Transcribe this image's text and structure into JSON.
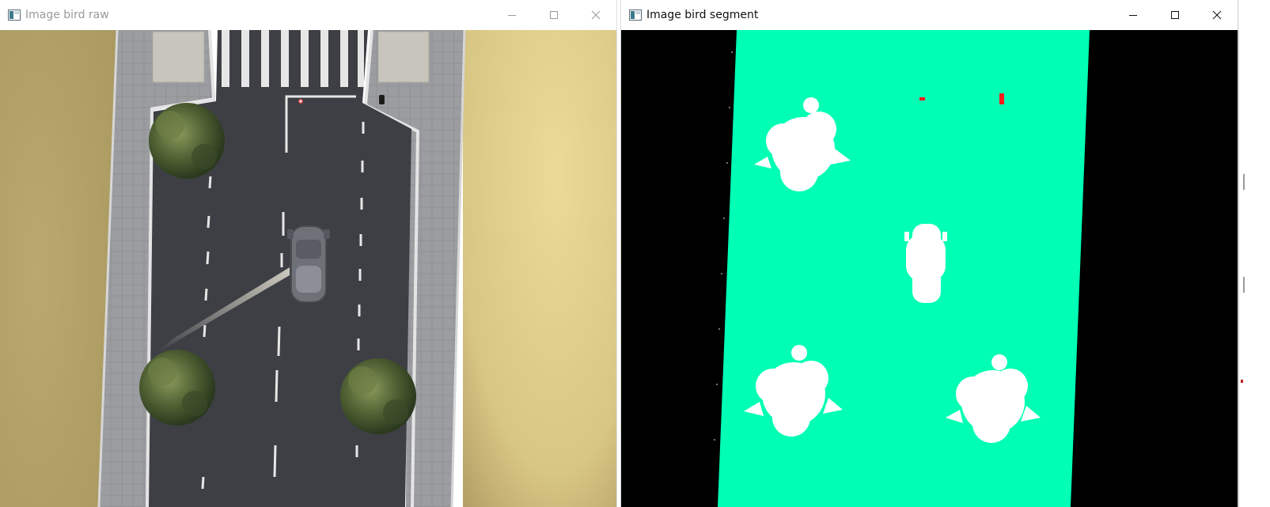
{
  "windows": [
    {
      "id": "raw",
      "title": "Image bird raw",
      "controls": [
        "minimize",
        "maximize",
        "close"
      ]
    },
    {
      "id": "segment",
      "title": "Image bird segment",
      "controls": [
        "minimize",
        "maximize",
        "close"
      ]
    }
  ],
  "icons": {
    "app": "opencv-window-icon",
    "minimize": "minimize-icon",
    "maximize": "maximize-icon",
    "close": "close-icon"
  },
  "colors": {
    "segment_road": "#00ffb4",
    "segment_background": "#000000",
    "segment_objects": "#ffffff",
    "segment_marker": "#ff1a1a",
    "grass": "#c9b67a",
    "asphalt": "#3e4046",
    "sidewalk": "#9a9ca0"
  }
}
